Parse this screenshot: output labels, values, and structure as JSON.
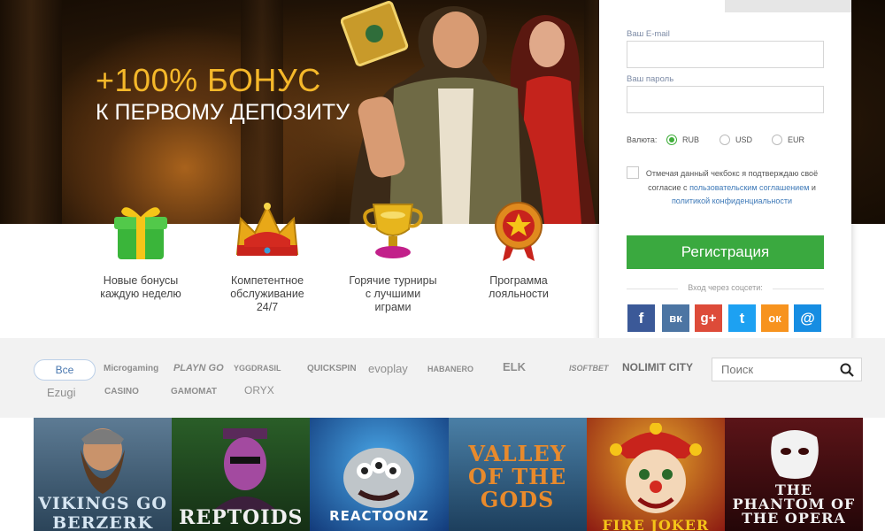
{
  "hero": {
    "title_line1": "+100% БОНУС",
    "title_line2": "К ПЕРВОМУ ДЕПОЗИТУ"
  },
  "features": [
    {
      "icon": "gift-icon",
      "label_l1": "Новые бонусы",
      "label_l2": "каждую неделю",
      "label_l3": ""
    },
    {
      "icon": "crown-icon",
      "label_l1": "Компетентное",
      "label_l2": "обслуживание",
      "label_l3": "24/7"
    },
    {
      "icon": "trophy-icon",
      "label_l1": "Горячие турниры",
      "label_l2": "с лучшими",
      "label_l3": "играми"
    },
    {
      "icon": "medal-icon",
      "label_l1": "Программа",
      "label_l2": "лояльности",
      "label_l3": ""
    }
  ],
  "registration": {
    "email_label": "Ваш E-mail",
    "email_value": "",
    "password_label": "Ваш пароль",
    "password_value": "",
    "currency_label": "Валюта:",
    "currencies": [
      {
        "code": "RUB",
        "selected": true
      },
      {
        "code": "USD",
        "selected": false
      },
      {
        "code": "EUR",
        "selected": false
      }
    ],
    "consent_text": "Отмечая данный чекбокс я подтверждаю своё согласие с",
    "consent_link1": "пользовательским соглашением",
    "consent_and": "и",
    "consent_link2": "политикой конфиденциальности",
    "consent_checked": false,
    "submit_label": "Регистрация",
    "social_label": "Вход через соцсети:",
    "social": [
      {
        "name": "facebook-icon",
        "glyph": "f",
        "color": "#3b5998"
      },
      {
        "name": "vk-icon",
        "glyph": "вк",
        "color": "#4c75a3"
      },
      {
        "name": "google-plus-icon",
        "glyph": "g+",
        "color": "#dd4b39"
      },
      {
        "name": "twitter-icon",
        "glyph": "t",
        "color": "#1da1f2"
      },
      {
        "name": "odnoklassniki-icon",
        "glyph": "ок",
        "color": "#f7931e"
      },
      {
        "name": "mail-icon",
        "glyph": "@",
        "color": "#168de2"
      }
    ]
  },
  "providers": {
    "all_label": "Все",
    "items": [
      "Microgaming",
      "PLAYN GO",
      "YGGDRASIL",
      "QUICKSPIN",
      "evoplay",
      "HABANERO",
      "ELK",
      "ISOFTBET",
      "NOLIMIT CITY",
      "Ezugi",
      "CASINO",
      "GAMOMAT",
      "ORYX"
    ],
    "search_placeholder": "Поиск"
  },
  "games": [
    {
      "title": "VIKINGS GO BERZERK",
      "bg": "#3e5a73"
    },
    {
      "title": "REPTOIDS",
      "bg": "#2c5a2a"
    },
    {
      "title": "REACTOONZ",
      "bg": "#1e5fa8"
    },
    {
      "title": "VALLEY OF THE GODS",
      "bg": "#2b6a8f"
    },
    {
      "title": "FIRE JOKER",
      "bg": "#b5261a"
    },
    {
      "title": "THE PHANTOM OF THE OPERA",
      "bg": "#4a0f12"
    }
  ]
}
